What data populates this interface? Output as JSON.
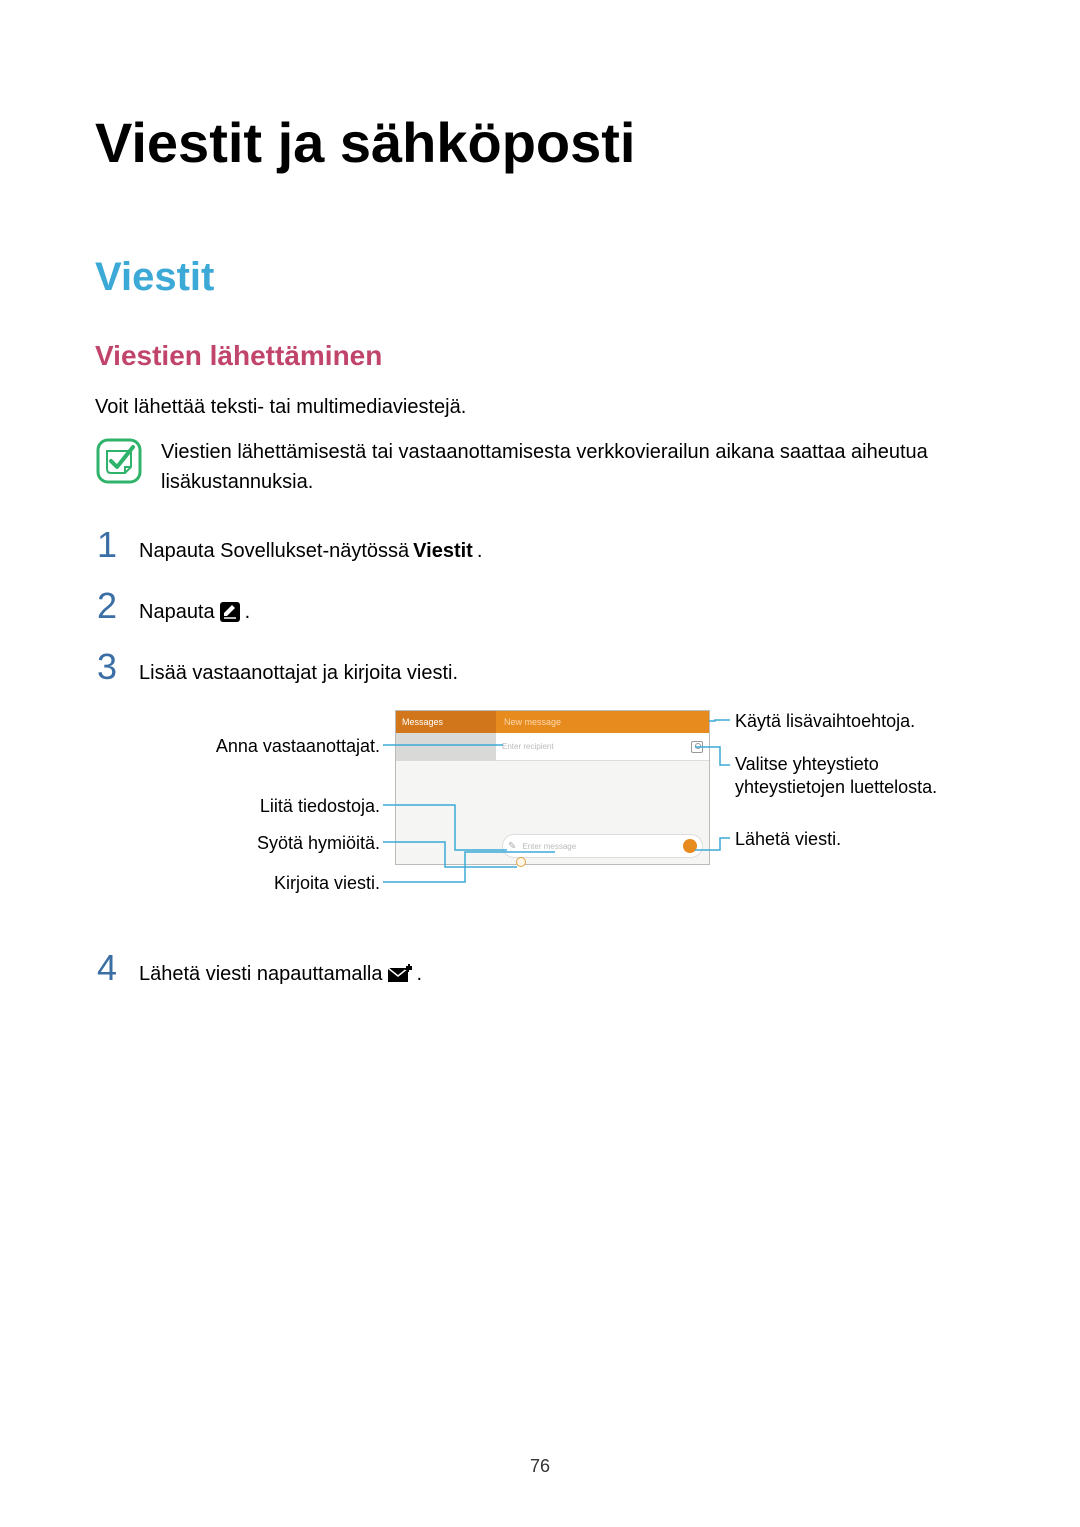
{
  "page_number": "76",
  "colors": {
    "accent_blue": "#3da9d6",
    "accent_pink": "#c1446b",
    "step_num": "#3a6ea5",
    "callout_line": "#3da9d6",
    "brand_orange": "#e78b1f"
  },
  "page_title": "Viestit ja sähköposti",
  "section_title": "Viestit",
  "subsection_title": "Viestien lähettäminen",
  "intro_text": "Voit lähettää teksti- tai multimediaviestejä.",
  "note_text": "Viestien lähettämisestä tai vastaanottamisesta verkkovierailun aikana saattaa aiheutua lisäkustannuksia.",
  "steps": [
    {
      "num": "1",
      "pre": "Napauta Sovellukset-näytössä ",
      "bold": "Viestit",
      "post": "."
    },
    {
      "num": "2",
      "pre": "Napauta ",
      "icon": "compose-icon",
      "post": "."
    },
    {
      "num": "3",
      "pre": "Lisää vastaanottajat ja kirjoita viesti."
    },
    {
      "num": "4",
      "pre": "Lähetä viesti napauttamalla ",
      "icon": "send-icon",
      "post": "."
    }
  ],
  "callouts": {
    "left": [
      "Anna vastaanottajat.",
      "Liitä tiedostoja.",
      "Syötä hymiöitä.",
      "Kirjoita viesti."
    ],
    "right": [
      "Käytä lisävaihtoehtoja.",
      "Valitse yhteystieto yhteystietojen luettelosta.",
      "Lähetä viesti."
    ]
  },
  "mock": {
    "header_left": "Messages",
    "header_right": "New message",
    "recipient_placeholder": "Enter recipient",
    "input_placeholder": "Enter message"
  }
}
